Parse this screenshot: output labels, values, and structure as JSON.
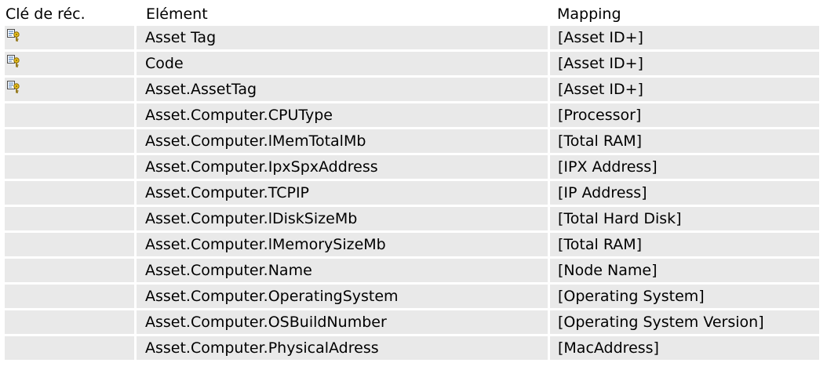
{
  "table": {
    "headers": {
      "key": "Clé de réc.",
      "element": "Elément",
      "mapping": "Mapping"
    },
    "rows": [
      {
        "key_icon": "key-icon",
        "element": "Asset Tag",
        "mapping": "[Asset ID+]"
      },
      {
        "key_icon": "key-icon",
        "element": "Code",
        "mapping": "[Asset ID+]"
      },
      {
        "key_icon": "key-icon",
        "element": "Asset.AssetTag",
        "mapping": "[Asset ID+]"
      },
      {
        "key_icon": "",
        "element": "Asset.Computer.CPUType",
        "mapping": "[Processor]"
      },
      {
        "key_icon": "",
        "element": "Asset.Computer.lMemTotalMb",
        "mapping": "[Total RAM]"
      },
      {
        "key_icon": "",
        "element": "Asset.Computer.IpxSpxAddress",
        "mapping": "[IPX Address]"
      },
      {
        "key_icon": "",
        "element": "Asset.Computer.TCPIP",
        "mapping": "[IP Address]"
      },
      {
        "key_icon": "",
        "element": "Asset.Computer.lDiskSizeMb",
        "mapping": "[Total Hard Disk]"
      },
      {
        "key_icon": "",
        "element": "Asset.Computer.lMemorySizeMb",
        "mapping": "[Total RAM]"
      },
      {
        "key_icon": "",
        "element": "Asset.Computer.Name",
        "mapping": "[Node Name]"
      },
      {
        "key_icon": "",
        "element": "Asset.Computer.OperatingSystem",
        "mapping": "[Operating System]"
      },
      {
        "key_icon": "",
        "element": "Asset.Computer.OSBuildNumber",
        "mapping": "[Operating System Version]"
      },
      {
        "key_icon": "",
        "element": "Asset.Computer.PhysicalAdress",
        "mapping": "[MacAddress]"
      }
    ]
  },
  "colors": {
    "cell_background": "#e9e9e9",
    "text": "#000000"
  }
}
